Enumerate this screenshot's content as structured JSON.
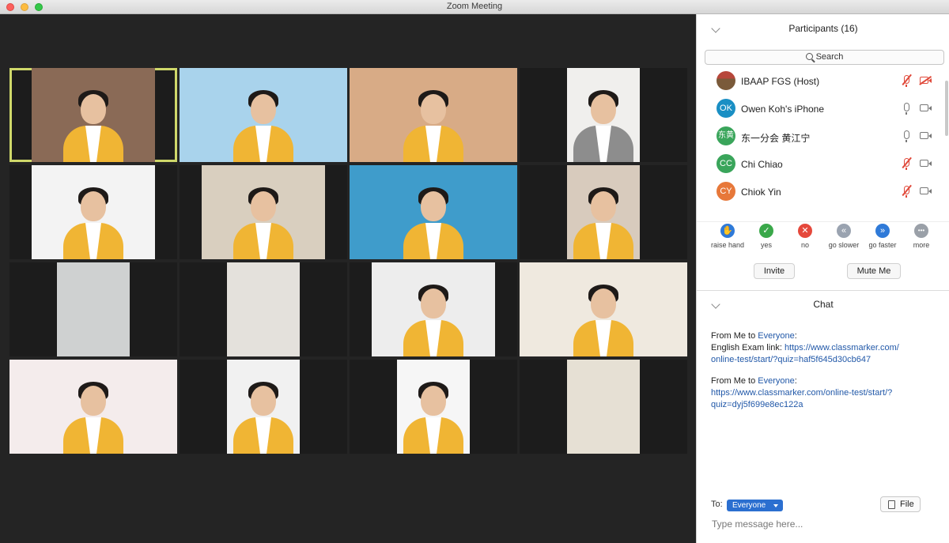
{
  "window": {
    "title": "Zoom Meeting"
  },
  "gallery": [
    {
      "bg": "#8a6a56",
      "framing": "pillar",
      "person": true,
      "active": true
    },
    {
      "bg": "#a9d3ec",
      "framing": "full",
      "person": true
    },
    {
      "bg": "#d8ab86",
      "framing": "full",
      "person": true
    },
    {
      "bg": "#f0efed",
      "framing": "pillar-n",
      "person": true,
      "outfit": "#8d8d8d"
    },
    {
      "bg": "#f3f3f3",
      "framing": "pillar",
      "person": true
    },
    {
      "bg": "#d9cfbf",
      "framing": "pillar",
      "person": true
    },
    {
      "bg": "#3f9ccb",
      "framing": "full",
      "person": true
    },
    {
      "bg": "#d8cbbd",
      "framing": "pillar-n",
      "person": true
    },
    {
      "bg": "#cfd1d1",
      "framing": "pillar-n",
      "person": false
    },
    {
      "bg": "#e4e1dc",
      "framing": "pillar-n",
      "person": false
    },
    {
      "bg": "#ededed",
      "framing": "pillar",
      "person": true
    },
    {
      "bg": "#efe9df",
      "framing": "full",
      "person": true
    },
    {
      "bg": "#f4ecec",
      "framing": "full",
      "person": true
    },
    {
      "bg": "#f1f1f1",
      "framing": "pillar-n",
      "person": true
    },
    {
      "bg": "#f6f6f6",
      "framing": "pillar-n",
      "person": true
    },
    {
      "bg": "#e6e0d4",
      "framing": "pillar-n",
      "person": false
    }
  ],
  "participants": {
    "title": "Participants (16)",
    "search_placeholder": "Search",
    "list": [
      {
        "initials": "",
        "name": "IBAAP FGS (Host)",
        "color": "",
        "mic_muted": true,
        "video_off": true
      },
      {
        "initials": "OK",
        "name": "Owen Koh's iPhone",
        "color": "#1a8fc4",
        "mic_muted": false,
        "video_off": false
      },
      {
        "initials": "东黄",
        "name": "东一分会 黄江宁",
        "color": "#3aa55b",
        "mic_muted": false,
        "video_off": false
      },
      {
        "initials": "CC",
        "name": "Chi Chiao",
        "color": "#3aa55b",
        "mic_muted": true,
        "video_off": false
      },
      {
        "initials": "CY",
        "name": "Chiok Yin",
        "color": "#e7783a",
        "mic_muted": true,
        "video_off": false
      }
    ],
    "reactions": [
      {
        "label": "raise hand",
        "icon": "raise-hand-icon",
        "glyph": "✋",
        "color": "#2f7ad8"
      },
      {
        "label": "yes",
        "icon": "yes-check-icon",
        "glyph": "✓",
        "color": "#3aa84a"
      },
      {
        "label": "no",
        "icon": "no-x-icon",
        "glyph": "✕",
        "color": "#e5483b"
      },
      {
        "label": "go slower",
        "icon": "go-slower-icon",
        "glyph": "«",
        "color": "#9aa3b0"
      },
      {
        "label": "go faster",
        "icon": "go-faster-icon",
        "glyph": "»",
        "color": "#2f7ad8"
      },
      {
        "label": "more",
        "icon": "more-icon",
        "glyph": "•••",
        "color": "#9aa0a8"
      }
    ],
    "invite_label": "Invite",
    "mute_me_label": "Mute Me"
  },
  "chat": {
    "title": "Chat",
    "messages": [
      {
        "from_prefix": "From Me to ",
        "recipient": "Everyone",
        "from_suffix": ":",
        "text": "English Exam link: ",
        "link_line1": "https://www.classmarker.com/",
        "link_line2": "online-test/start/?quiz=haf5f645d30cb647"
      },
      {
        "from_prefix": "From Me to ",
        "recipient": "Everyone",
        "from_suffix": ":",
        "link_line1": "https://www.classmarker.com/online-test/start/?",
        "link_line2": "quiz=dyj5f699e8ec122a"
      }
    ],
    "to_label": "To:",
    "to_value": "Everyone",
    "file_label": "File",
    "input_placeholder": "Type message here..."
  }
}
